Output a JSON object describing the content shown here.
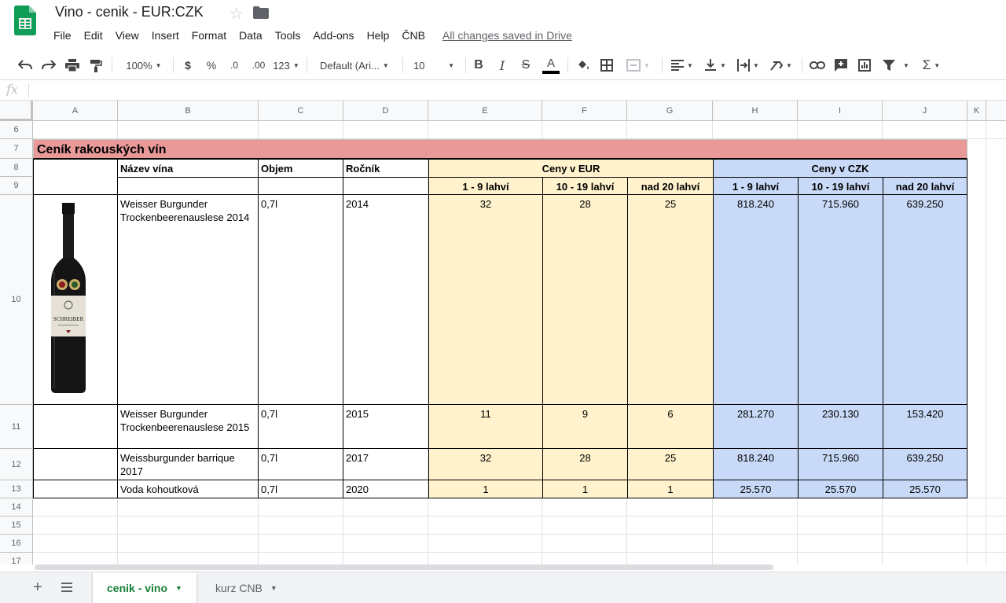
{
  "window": {
    "doc_title": "Vino - cenik - EUR:CZK",
    "save_status": "All changes saved in Drive"
  },
  "menu": [
    "File",
    "Edit",
    "View",
    "Insert",
    "Format",
    "Data",
    "Tools",
    "Add-ons",
    "Help",
    "ČNB"
  ],
  "toolbar": {
    "zoom": "100%",
    "currency": "$",
    "percent": "%",
    "decrease_decimal": ".0",
    "increase_decimal": ".00",
    "more_formats": "123",
    "font": "Default (Ari...",
    "font_size": "10",
    "bold": "B",
    "italic": "I",
    "strikethrough": "S",
    "text_color": "A",
    "text_color_value": "#000000",
    "sum": "Σ"
  },
  "formula_bar": {
    "fx": "fx",
    "value": ""
  },
  "columns": [
    "A",
    "B",
    "C",
    "D",
    "E",
    "F",
    "G",
    "H",
    "I",
    "J",
    "K"
  ],
  "rows": [
    "6",
    "7",
    "8",
    "9",
    "10",
    "11",
    "12",
    "13",
    "14",
    "15",
    "16",
    "17"
  ],
  "sheet": {
    "title": "Ceník rakouských vín",
    "headers": {
      "name": "Název vína",
      "volume": "Objem",
      "year": "Ročník",
      "eur_group": "Ceny v EUR",
      "czk_group": "Ceny v CZK",
      "tier1": "1 - 9 lahví",
      "tier2": "10 - 19 lahví",
      "tier3": "nad 20 lahví"
    },
    "wines": [
      {
        "name": "Weisser Burgunder Trockenbeerenauslese 2014",
        "volume": "0,7l",
        "year": "2014",
        "eur": [
          "32",
          "28",
          "25"
        ],
        "czk": [
          "818.240",
          "715.960",
          "639.250"
        ]
      },
      {
        "name": "Weisser Burgunder Trockenbeerenauslese 2015",
        "volume": "0,7l",
        "year": "2015",
        "eur": [
          "11",
          "9",
          "6"
        ],
        "czk": [
          "281.270",
          "230.130",
          "153.420"
        ]
      },
      {
        "name": "Weissburgunder barrique 2017",
        "volume": "0,7l",
        "year": "2017",
        "eur": [
          "32",
          "28",
          "25"
        ],
        "czk": [
          "818.240",
          "715.960",
          "639.250"
        ]
      },
      {
        "name": "Voda kohoutková",
        "volume": "0,7l",
        "year": "2020",
        "eur": [
          "1",
          "1",
          "1"
        ],
        "czk": [
          "25.570",
          "25.570",
          "25.570"
        ]
      }
    ],
    "bottle_label": "SCHREIBER"
  },
  "colors": {
    "title_fill": "#ea9999",
    "eur_fill": "#fff2cc",
    "czk_fill": "#c9daf8",
    "active_tab": "#188038"
  },
  "sheet_tabs": [
    {
      "label": "cenik - vino",
      "active": true
    },
    {
      "label": "kurz CNB",
      "active": false
    }
  ]
}
